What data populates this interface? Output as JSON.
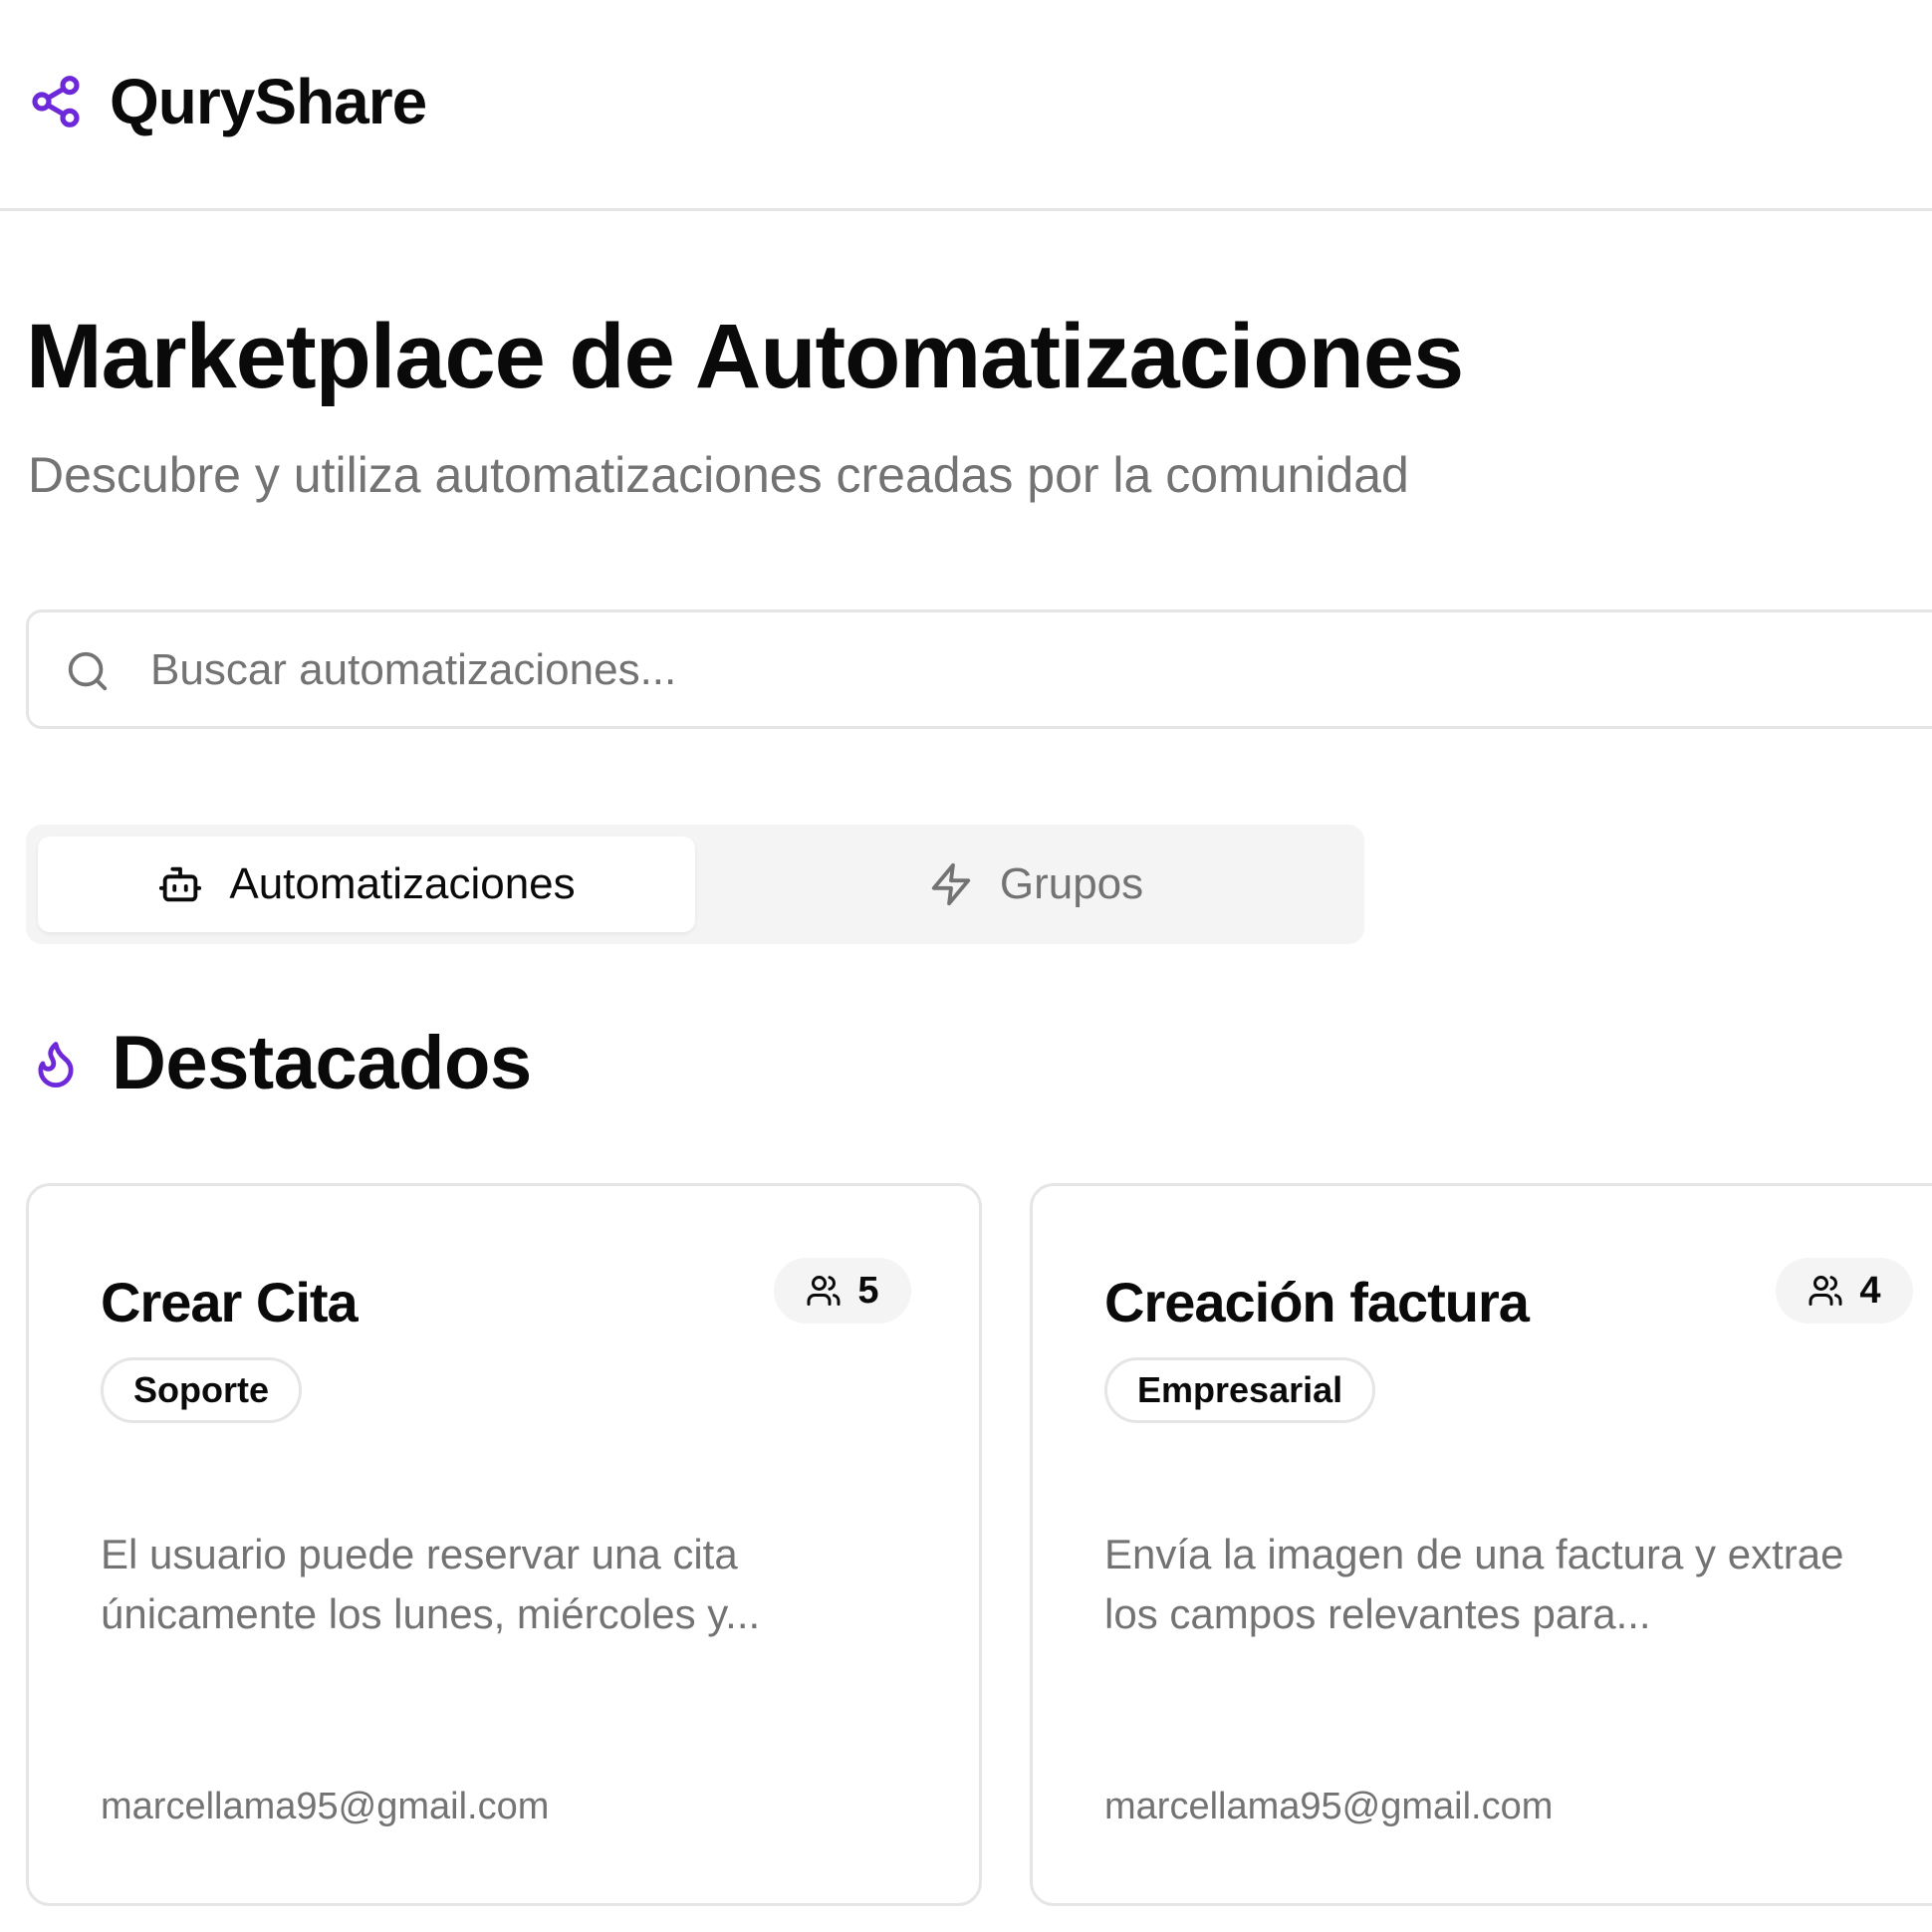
{
  "app": {
    "name": "QuryShare",
    "icon": "share-icon"
  },
  "page": {
    "title": "Marketplace de Automatizaciones",
    "subtitle": "Descubre y utiliza automatizaciones creadas por la comunidad"
  },
  "search": {
    "placeholder": "Buscar automatizaciones...",
    "value": "",
    "icon": "search-icon"
  },
  "tabs": [
    {
      "label": "Automatizaciones",
      "icon": "bot-icon",
      "active": true
    },
    {
      "label": "Grupos",
      "icon": "zap-icon",
      "active": false
    }
  ],
  "section": {
    "title": "Destacados",
    "icon": "flame-icon"
  },
  "cards": [
    {
      "title": "Crear Cita",
      "users": "5",
      "tag": "Soporte",
      "description": "El usuario puede reservar una cita únicamente los lunes, miércoles y...",
      "author": "marcellama95@gmail.com"
    },
    {
      "title": "Creación factura",
      "users": "4",
      "tag": "Empresarial",
      "description": "Envía la imagen de una factura y extrae los campos relevantes para...",
      "author": "marcellama95@gmail.com"
    }
  ],
  "colors": {
    "accent": "#6d28d9",
    "muted_text": "#737373",
    "border": "#e5e5e5",
    "tab_bg": "#f4f4f5"
  }
}
